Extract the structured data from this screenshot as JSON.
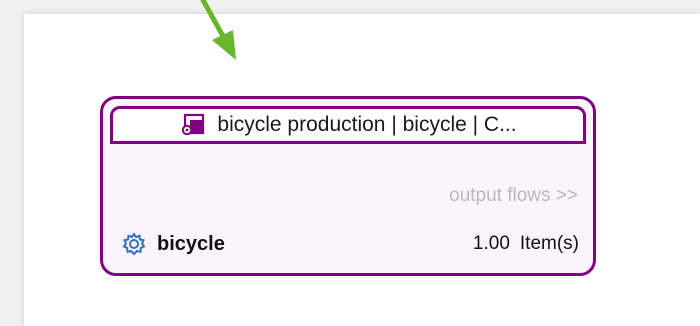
{
  "colors": {
    "node_border": "#800080",
    "node_fill": "#fdf3fd",
    "arrow": "#6ab52e",
    "gear_icon": "#2f6fc2",
    "muted_text": "#b9b9b9"
  },
  "process_node": {
    "title": "bicycle production | bicycle | C...",
    "header_icon": "process-icon",
    "output_flows_label": "output flows >>",
    "flows": [
      {
        "icon": "gear-icon",
        "name": "bicycle",
        "amount": "1.00",
        "unit": "Item(s)"
      }
    ]
  }
}
